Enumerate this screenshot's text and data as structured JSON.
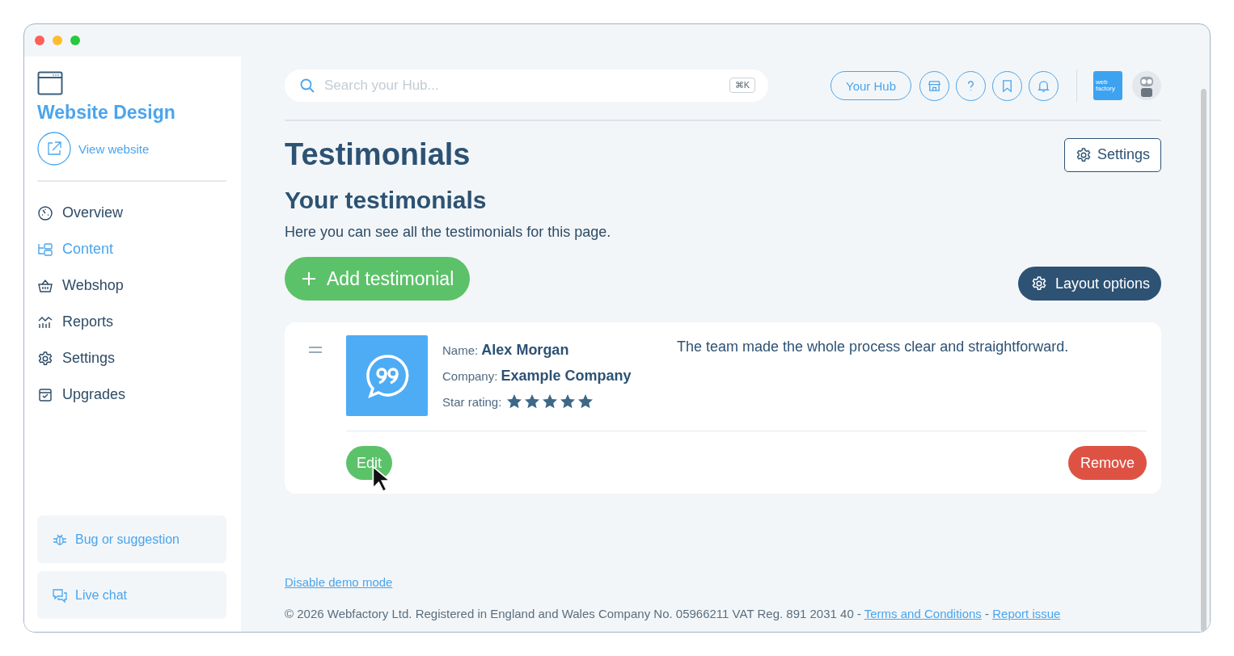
{
  "sidebar": {
    "title": "Website Design",
    "view_link": "View website",
    "items": [
      {
        "label": "Overview",
        "kind": "gauge",
        "selected": false
      },
      {
        "label": "Content",
        "kind": "tree",
        "selected": true
      },
      {
        "label": "Webshop",
        "kind": "basket",
        "selected": false
      },
      {
        "label": "Reports",
        "kind": "chart",
        "selected": false
      },
      {
        "label": "Settings",
        "kind": "gear",
        "selected": false
      },
      {
        "label": "Upgrades",
        "kind": "box",
        "selected": false
      }
    ],
    "bottom_buttons": [
      {
        "label": "Bug or suggestion",
        "kind": "bug"
      },
      {
        "label": "Live chat",
        "kind": "chat"
      }
    ]
  },
  "topbar": {
    "search": {
      "placeholder": "Search your Hub...",
      "shortcut": "⌘K"
    },
    "hub_button": "Your Hub",
    "icon_buttons": [
      {
        "kind": "shop"
      },
      {
        "kind": "help"
      },
      {
        "kind": "bookmark"
      },
      {
        "kind": "bell"
      }
    ],
    "logo_lines": [
      "web",
      "factory"
    ]
  },
  "page": {
    "title": "Testimonials",
    "settings_button": "Settings",
    "subtitle": "Your testimonials",
    "description": "Here you can see all the testimonials for this page.",
    "add_button": "Add testimonial",
    "layout_button": "Layout options"
  },
  "testimonials": [
    {
      "fields": [
        {
          "label": "Name:",
          "value": "Alex Morgan"
        },
        {
          "label": "Company:",
          "value": "Example Company"
        }
      ],
      "rating_label": "Star rating:",
      "stars": 5,
      "quote": "The team made the whole process clear and straightforward.",
      "edit": "Edit",
      "remove": "Remove"
    }
  ],
  "footer": {
    "demo_link": "Disable demo mode",
    "parts": [
      {
        "kind": "text",
        "text": "© 2026 Webfactory Ltd. Registered in England and Wales Company No. 05966211 VAT Reg. 891 2031 40 - "
      },
      {
        "kind": "link",
        "text": "Terms and Conditions"
      },
      {
        "kind": "text",
        "text": " - "
      },
      {
        "kind": "link",
        "text": "Report issue"
      }
    ]
  }
}
